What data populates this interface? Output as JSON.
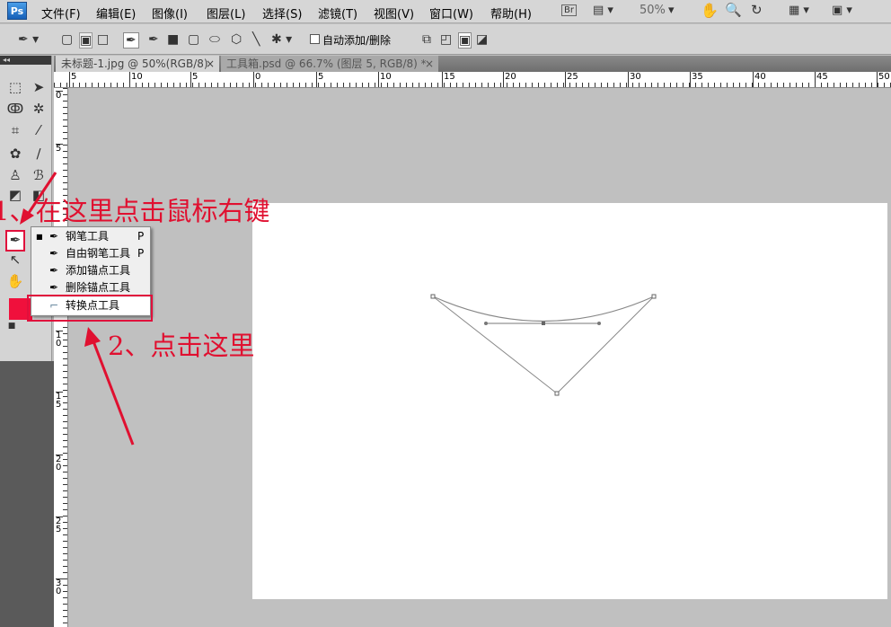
{
  "app": {
    "logo": "Ps"
  },
  "menu": [
    "文件(F)",
    "编辑(E)",
    "图像(I)",
    "图层(L)",
    "选择(S)",
    "滤镜(T)",
    "视图(V)",
    "窗口(W)",
    "帮助(H)"
  ],
  "appbar": {
    "bridge": "Br",
    "zoom": "50%"
  },
  "options": {
    "auto_add_delete": "自动添加/删除"
  },
  "tabs": [
    {
      "label": "未标题-1.jpg @ 50%(RGB/8)",
      "close": "×"
    },
    {
      "label": "工具箱.psd @ 66.7% (图层 5, RGB/8) *",
      "close": "×"
    }
  ],
  "ruler": {
    "h": [
      "5",
      "10",
      "5",
      "0",
      "5",
      "10",
      "15",
      "20",
      "25",
      "30",
      "35",
      "40",
      "45",
      "50"
    ],
    "v": [
      "0",
      "5",
      "1 0",
      "1 5",
      "2 0",
      "2 5",
      "3 0"
    ]
  },
  "context_menu": [
    {
      "label": "钢笔工具",
      "shortcut": "P",
      "selected": true
    },
    {
      "label": "自由钢笔工具",
      "shortcut": "P"
    },
    {
      "label": "添加锚点工具",
      "shortcut": ""
    },
    {
      "label": "删除锚点工具",
      "shortcut": ""
    },
    {
      "label": "转换点工具",
      "shortcut": "",
      "highlighted": true
    }
  ],
  "annotations": {
    "step1": "1、在这里点击鼠标右键",
    "step2": "2、点击这里"
  },
  "colors": {
    "foreground": "#f0103c",
    "accent": "#e0103c"
  }
}
